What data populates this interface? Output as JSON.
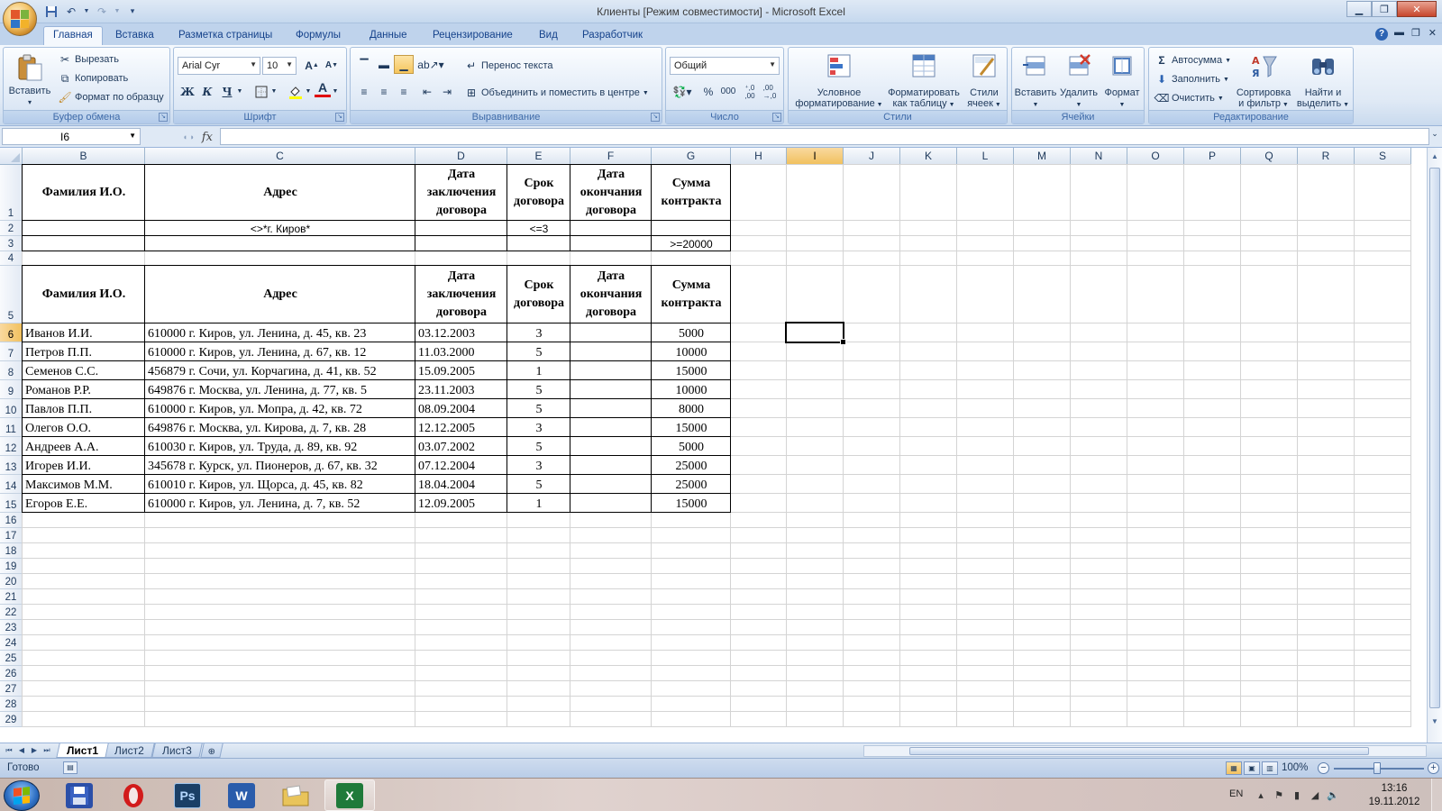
{
  "window": {
    "title": "Клиенты  [Режим совместимости] - Microsoft Excel"
  },
  "ribbon": {
    "tabs": [
      "Главная",
      "Вставка",
      "Разметка страницы",
      "Формулы",
      "Данные",
      "Рецензирование",
      "Вид",
      "Разработчик"
    ],
    "active_tab": "Главная",
    "clipboard": {
      "paste": "Вставить",
      "cut": "Вырезать",
      "copy": "Копировать",
      "format_painter": "Формат по образцу",
      "label": "Буфер обмена"
    },
    "font": {
      "name": "Arial Cyr",
      "size": "10",
      "bold": "Ж",
      "italic": "К",
      "underline": "Ч",
      "label": "Шрифт"
    },
    "alignment": {
      "wrap_text": "Перенос текста",
      "merge_center": "Объединить и поместить в центре",
      "label": "Выравнивание"
    },
    "number": {
      "format": "Общий",
      "label": "Число"
    },
    "styles": {
      "conditional_1": "Условное",
      "conditional_2": "форматирование",
      "as_table_1": "Форматировать",
      "as_table_2": "как таблицу",
      "cell_styles_1": "Стили",
      "cell_styles_2": "ячеек",
      "label": "Стили"
    },
    "cells": {
      "insert": "Вставить",
      "delete": "Удалить",
      "format": "Формат",
      "label": "Ячейки"
    },
    "editing": {
      "autosum": "Автосумма",
      "fill": "Заполнить",
      "clear": "Очистить",
      "sort_1": "Сортировка",
      "sort_2": "и фильтр",
      "find_1": "Найти и",
      "find_2": "выделить",
      "label": "Редактирование"
    }
  },
  "formula_bar": {
    "name_box": "I6",
    "fx": "fx",
    "formula": ""
  },
  "grid": {
    "columns": [
      "B",
      "C",
      "D",
      "E",
      "F",
      "G",
      "H",
      "I",
      "J",
      "K",
      "L",
      "M",
      "N",
      "O",
      "P",
      "Q",
      "R",
      "S"
    ],
    "selected_column": "I",
    "rows": [
      "1",
      "2",
      "3",
      "4",
      "5",
      "6",
      "7",
      "8",
      "9",
      "10",
      "11",
      "12",
      "13",
      "14",
      "15",
      "16",
      "17",
      "18",
      "19",
      "20",
      "21",
      "22",
      "23",
      "24",
      "25",
      "26",
      "27",
      "28",
      "29"
    ],
    "selected_row": "6",
    "active_cell": "I6",
    "headers": {
      "fio": "Фамилия И.О.",
      "address": "Адрес",
      "date_start": "Дата заключения договора",
      "term": "Срок договора",
      "date_end": "Дата окончания договора",
      "amount": "Сумма контракта"
    },
    "criteria": {
      "row2_address": "<>*г. Киров*",
      "row2_term": "<=3",
      "row3_amount": ">=20000"
    },
    "data_rows": [
      [
        "Иванов И.И.",
        "610000 г. Киров, ул. Ленина, д. 45, кв. 23",
        "03.12.2003",
        "3",
        "",
        "5000"
      ],
      [
        "Петров П.П.",
        "610000 г. Киров, ул. Ленина, д. 67, кв. 12",
        "11.03.2000",
        "5",
        "",
        "10000"
      ],
      [
        "Семенов С.С.",
        "456879 г. Сочи, ул. Корчагина, д. 41, кв. 52",
        "15.09.2005",
        "1",
        "",
        "15000"
      ],
      [
        "Романов Р.Р.",
        "649876 г. Москва, ул. Ленина, д. 77, кв. 5",
        "23.11.2003",
        "5",
        "",
        "10000"
      ],
      [
        "Павлов П.П.",
        "610000 г. Киров, ул. Мопра, д. 42, кв. 72",
        "08.09.2004",
        "5",
        "",
        "8000"
      ],
      [
        "Олегов О.О.",
        "649876 г. Москва, ул. Кирова, д. 7, кв. 28",
        "12.12.2005",
        "3",
        "",
        "15000"
      ],
      [
        "Андреев А.А.",
        "610030 г. Киров, ул. Труда, д. 89, кв. 92",
        "03.07.2002",
        "5",
        "",
        "5000"
      ],
      [
        "Игорев И.И.",
        "345678 г. Курск, ул. Пионеров, д. 67, кв. 32",
        "07.12.2004",
        "3",
        "",
        "25000"
      ],
      [
        "Максимов М.М.",
        "610010 г. Киров, ул. Щорса, д. 45, кв. 82",
        "18.04.2004",
        "5",
        "",
        "25000"
      ],
      [
        "Егоров Е.Е.",
        "610000 г. Киров, ул. Ленина, д. 7, кв. 52",
        "12.09.2005",
        "1",
        "",
        "15000"
      ]
    ]
  },
  "sheets": {
    "tabs": [
      "Лист1",
      "Лист2",
      "Лист3"
    ],
    "active": "Лист1"
  },
  "status": {
    "text": "Готово",
    "zoom": "100%"
  },
  "taskbar": {
    "lang": "EN",
    "time": "13:16",
    "date": "19.11.2012"
  },
  "colors": {
    "ribbon_bg": "#dfe9f5",
    "selected_header": "#f1c15f",
    "excel_green": "#1f7a3a"
  },
  "icons": [
    "office-button-icon",
    "save-icon",
    "undo-icon",
    "redo-icon",
    "paste-icon",
    "scissors-icon",
    "copy-icon",
    "brush-icon",
    "sigma-icon",
    "sort-filter-icon",
    "binoculars-icon"
  ]
}
